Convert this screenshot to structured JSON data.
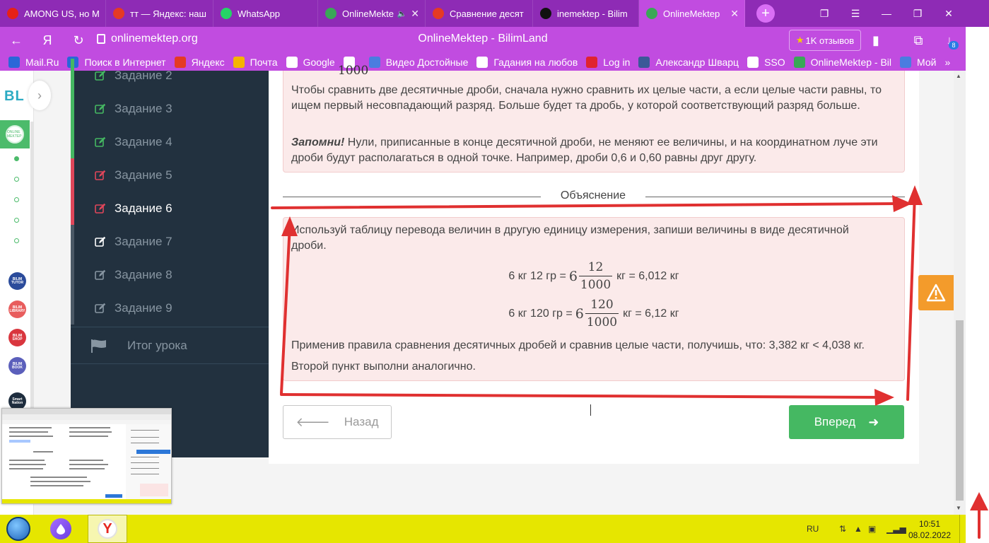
{
  "tabs": [
    {
      "label": "AMONG US, но М",
      "icon_color": "#e62117",
      "icon": "youtube-icon",
      "width": 150
    },
    {
      "label": "тт — Яндекс: наш",
      "icon_color": "#e53a24",
      "icon": "yandex-icon",
      "width": 152
    },
    {
      "label": "WhatsApp",
      "icon_color": "#25d366",
      "icon": "whatsapp-icon",
      "width": 148
    },
    {
      "label": "OnlineMekte",
      "icon_color": "#3aa757",
      "icon": "onlinemektep-icon",
      "width": 152,
      "muted": true
    },
    {
      "label": "Сравнение десят",
      "icon_color": "#e53a24",
      "icon": "yandex-icon",
      "width": 152
    },
    {
      "label": "inemektep - Bilim",
      "icon_color": "#111111",
      "icon": "z-icon",
      "width": 150
    },
    {
      "label": "OnlineMektep",
      "icon_color": "#3aa757",
      "icon": "onlinemektep-icon",
      "width": 150,
      "active": true
    }
  ],
  "address": {
    "url": "onlinemektep.org",
    "page_title": "OnlineMektep - BilimLand",
    "reviews": "1K отзывов",
    "downloads_badge": "8"
  },
  "bookmarks": [
    {
      "label": "Mail.Ru",
      "color": "#2a67d8",
      "icon": "mailru-icon"
    },
    {
      "label": "Поиск в Интернет",
      "color": "#2a67d8",
      "icon": "search-icon"
    },
    {
      "label": "Яндекс",
      "color": "#e53a24",
      "icon": "yandex-icon"
    },
    {
      "label": "Почта",
      "color": "#f5b400",
      "icon": "mail-icon"
    },
    {
      "label": "Google",
      "color": "#ffffff",
      "icon": "google-icon"
    },
    {
      "label": "",
      "color": "#ffffff",
      "icon": "google-icon"
    },
    {
      "label": "Видео Достойные",
      "color": "#4a7de0",
      "icon": "video-icon"
    },
    {
      "label": "Гадания на любов",
      "color": "#ffffff",
      "icon": "cards-icon"
    },
    {
      "label": "Log in",
      "color": "#e0232f",
      "icon": "nc-icon"
    },
    {
      "label": "Александр Шварц",
      "color": "#3b5998",
      "icon": "facebook-icon"
    },
    {
      "label": "SSO",
      "color": "#ffffff",
      "icon": "egov-icon"
    },
    {
      "label": "OnlineMektep - Bil",
      "color": "#3aa757",
      "icon": "onlinemektep-icon"
    },
    {
      "label": "Мой",
      "color": "#4a7de0",
      "icon": "profile-icon"
    }
  ],
  "mini_sidebar": {
    "logo": "BL",
    "active_label": "ONLINE MEKTEP",
    "apps": [
      {
        "label": "BILIM TUTOR",
        "color": "#2b4b9b"
      },
      {
        "label": "BILIM LIBRARY",
        "color": "#e85d5d"
      },
      {
        "label": "BILIM SHOP",
        "color": "#d9363e"
      },
      {
        "label": "BILIM BOOK",
        "color": "#5b5fbb"
      },
      {
        "label": "Smart Nation",
        "color": "#1e2d3e"
      }
    ]
  },
  "lesson_nav": {
    "tasks": [
      {
        "label": "Задание 2",
        "status_color": "#45b862",
        "icon_color": "#45b862"
      },
      {
        "label": "Задание 3",
        "status_color": "#45b862",
        "icon_color": "#45b862"
      },
      {
        "label": "Задание 4",
        "status_color": "#45b862",
        "icon_color": "#45b862"
      },
      {
        "label": "Задание 5",
        "status_color": "#e0465a",
        "icon_color": "#e0465a"
      },
      {
        "label": "Задание 6",
        "status_color": "#e0465a",
        "icon_color": "#e0465a",
        "current": true
      },
      {
        "label": "Задание 7",
        "status_color": "#4b5966",
        "icon_color": "#ffffff"
      },
      {
        "label": "Задание 8",
        "status_color": "#4b5966",
        "icon_color": "#8795a1"
      },
      {
        "label": "Задание 9",
        "status_color": "#4b5966",
        "icon_color": "#8795a1"
      }
    ],
    "summary": "Итог урока"
  },
  "rule": {
    "fraction_den": "1000",
    "p1": "Чтобы сравнить две десятичные дроби, сначала нужно сравнить их целые части, а если целые части равны, то ищем первый несовпадающий разряд. Больше будет та дробь, у которой соответствующий разряд больше.",
    "remember_label": "Запомни!",
    "p2": " Нули, приписанные в конце десятичной дроби, не меняют ее величины, и на координатном луче эти дроби будут располагаться в одной точке. Например, дроби 0,6 и 0,60 равны друг другу."
  },
  "explanation": {
    "heading": "Объяснение",
    "intro_line1": "Используй таблицу перевода величин в другую единицу измерения, запиши величины в виде десятичной",
    "intro_line2": "дроби.",
    "formula1": {
      "left": "6 кг 12 гр =",
      "whole": "6",
      "num": "12",
      "den": "1000",
      "right": "кг = 6,012 кг"
    },
    "formula2": {
      "left": "6 кг 120 гр =",
      "whole": "6",
      "num": "120",
      "den": "1000",
      "right": "кг = 6,12 кг"
    },
    "conclusion": "Применив правила сравнения десятичных дробей и сравнив целые части, получишь, что: 3,382 кг < 4,038 кг.",
    "second": "Второй пункт выполни аналогично."
  },
  "buttons": {
    "back": "Назад",
    "next": "Вперед"
  },
  "taskbar": {
    "lang": "RU",
    "time": "10:51",
    "date": "08.02.2022"
  },
  "colors": {
    "browser_tabbar": "#8e2bb5",
    "browser_active": "#c14ce0",
    "sidebar_dark": "#22313f",
    "rule_box": "#fbeaea",
    "next_green": "#45b862",
    "warning_orange": "#f39b2b",
    "annotation_red": "#e03030",
    "taskbar_yellow": "#e6e600"
  }
}
